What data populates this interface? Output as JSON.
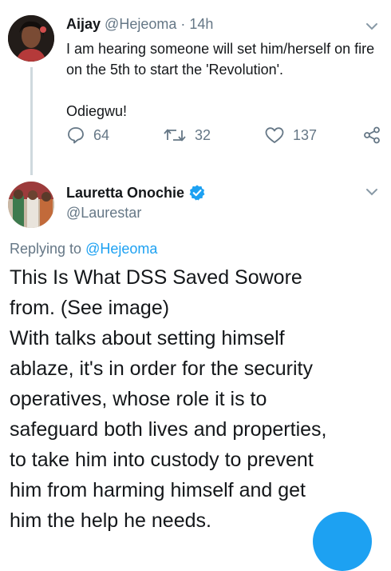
{
  "tweet1": {
    "display_name": "Aijay",
    "handle": "@Hejeoma",
    "separator": "·",
    "time": "14h",
    "text_line1": "I am hearing someone will set him/herself on fire on the 5th to start the 'Revolution'.",
    "text_line2": "Odiegwu!",
    "replies": "64",
    "retweets": "32",
    "likes": "137"
  },
  "tweet2": {
    "display_name": "Lauretta Onochie",
    "handle": "@Laurestar",
    "verified": true,
    "replying_prefix": "Replying to",
    "replying_to": "@Hejeoma",
    "body_lines": [
      "This Is What DSS Saved Sowore",
      "from. (See image)",
      "With talks about setting himself",
      "ablaze, it's in order for the security",
      "operatives, whose role it is to",
      "safeguard both lives and properties,",
      "to take him into custody to prevent",
      "him from harming himself and get",
      "him the help he needs."
    ]
  },
  "colors": {
    "accent": "#1da1f2",
    "muted": "#657786",
    "text": "#14171a"
  },
  "icons": [
    "reply-icon",
    "retweet-icon",
    "like-icon",
    "share-icon",
    "verified-badge-icon",
    "chevron-down-icon"
  ]
}
